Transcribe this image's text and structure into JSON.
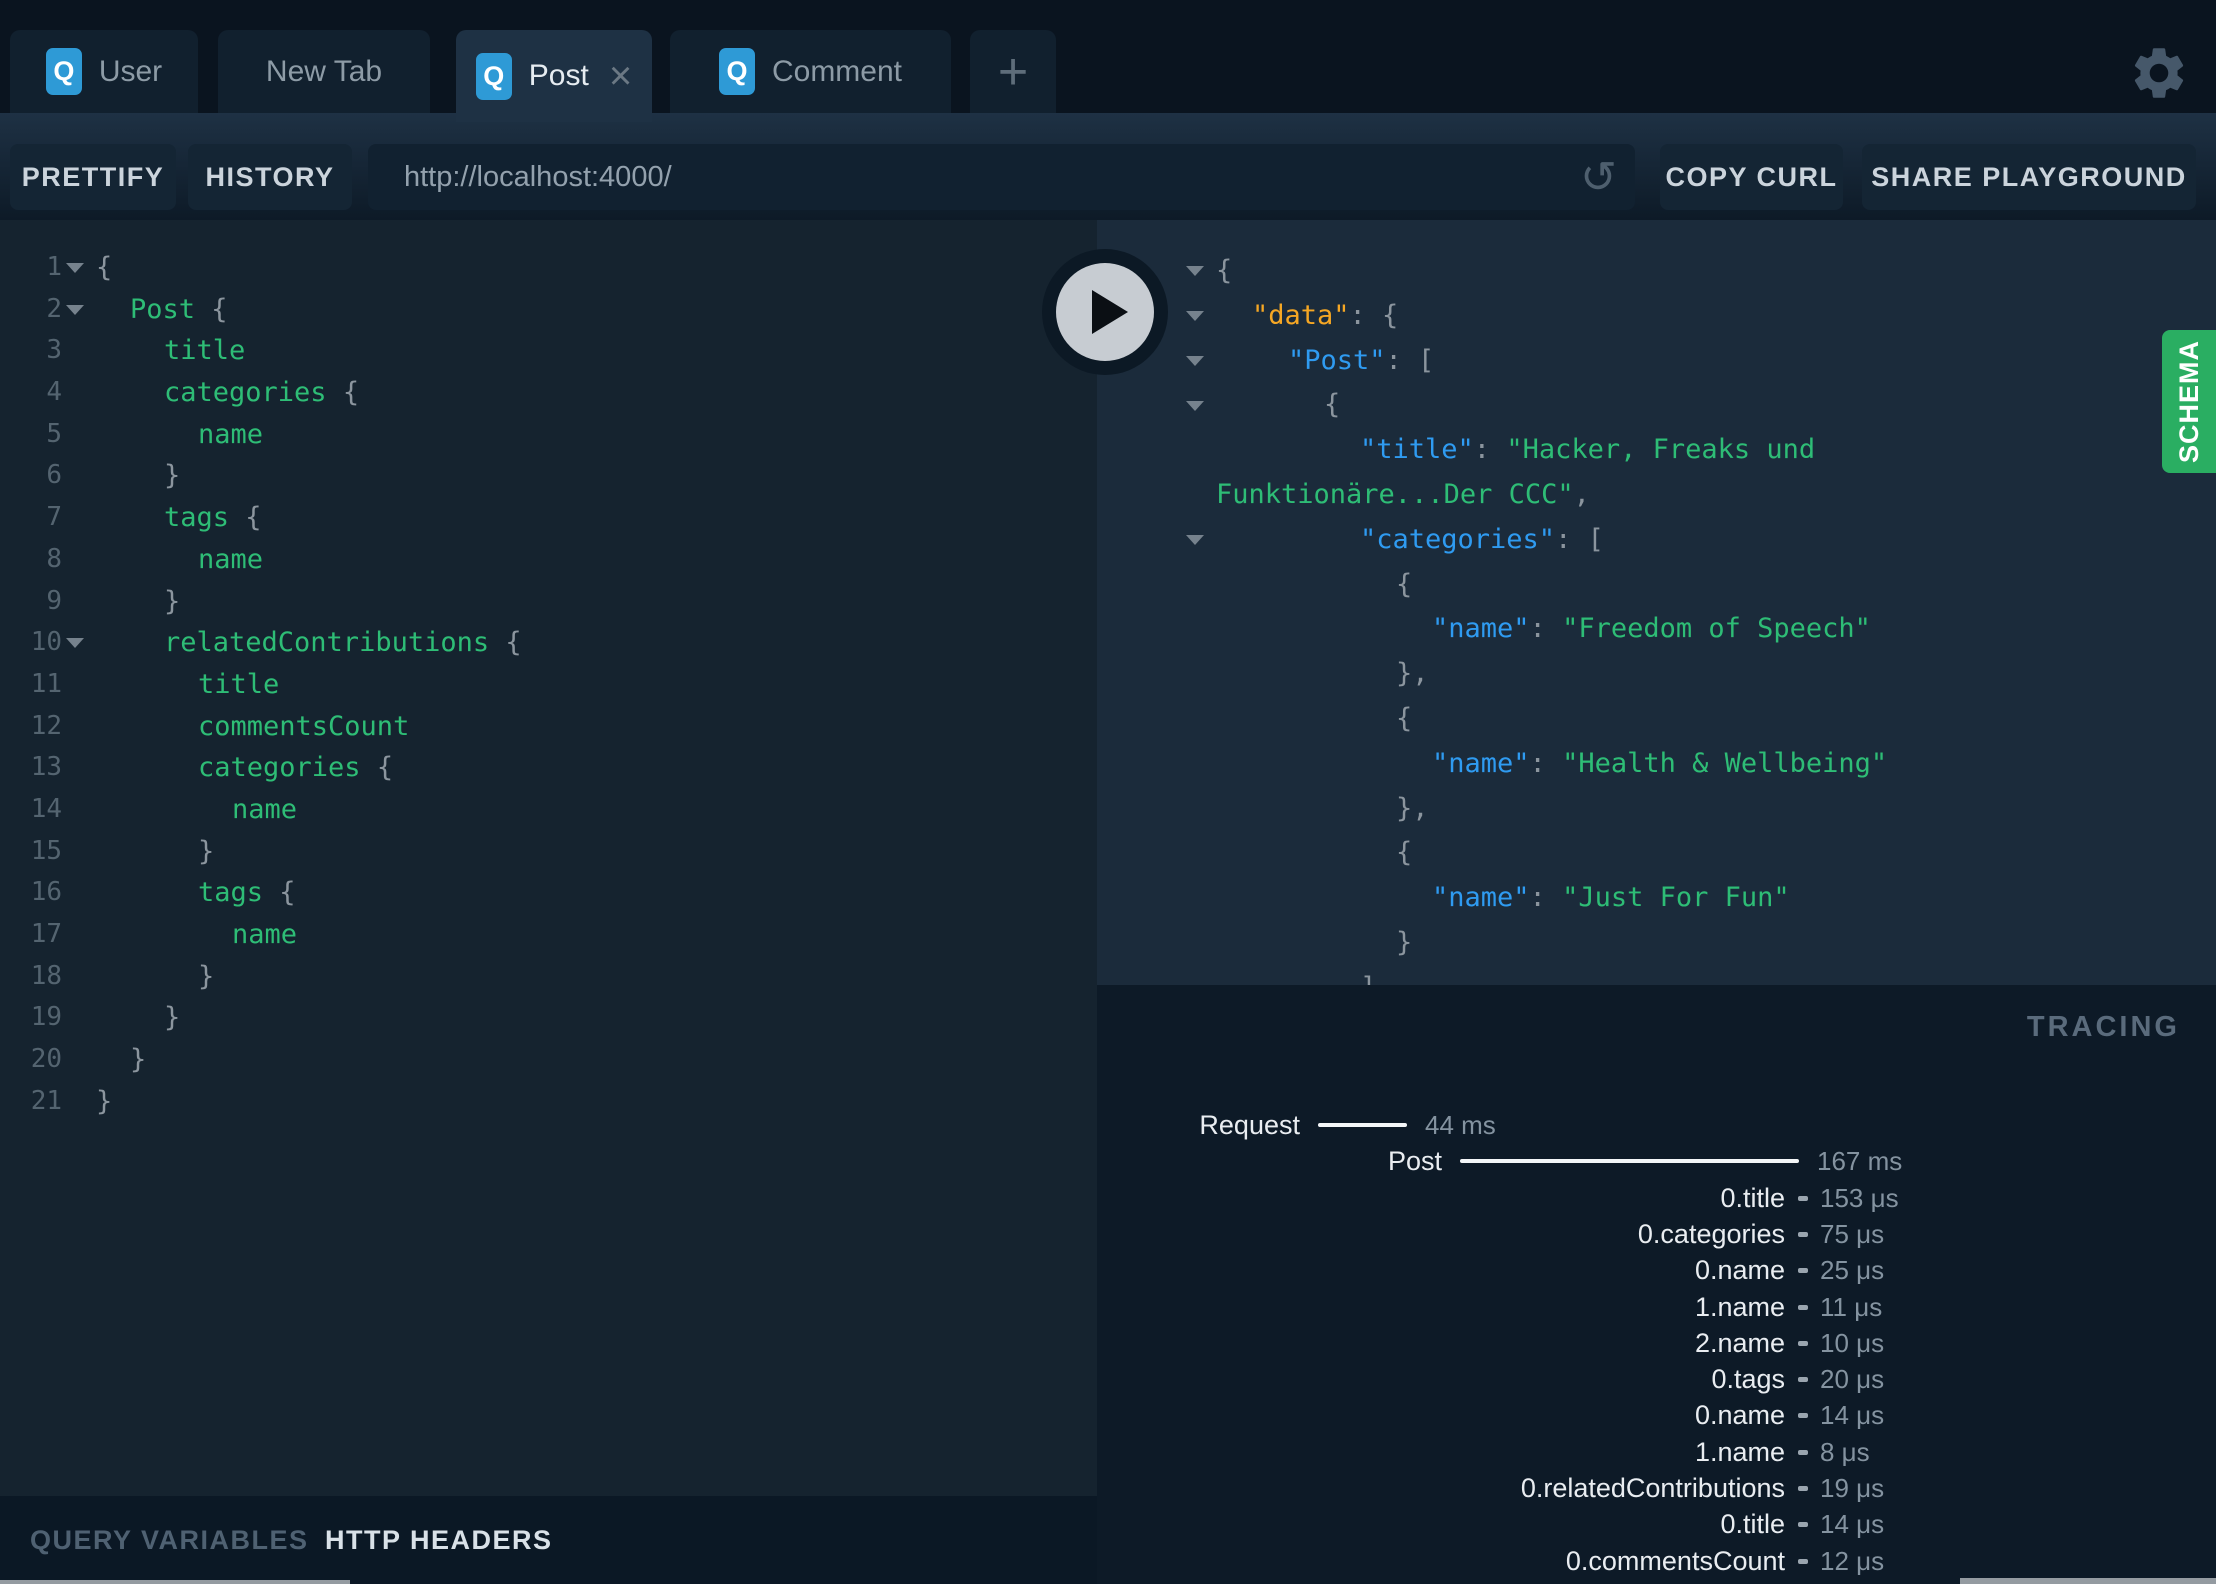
{
  "tabs": {
    "items": [
      {
        "label": "User",
        "badge": "Q",
        "active": false,
        "closable": false
      },
      {
        "label": "New Tab",
        "badge": "",
        "active": false,
        "closable": false
      },
      {
        "label": "Post",
        "badge": "Q",
        "active": true,
        "closable": true
      },
      {
        "label": "Comment",
        "badge": "Q",
        "active": false,
        "closable": false
      }
    ],
    "new_tab_button": "+",
    "close_glyph": "×"
  },
  "toolbar": {
    "prettify": "PRETTIFY",
    "history": "HISTORY",
    "url": "http://localhost:4000/",
    "reload_glyph": "↺",
    "copy_curl": "COPY CURL",
    "share": "SHARE PLAYGROUND"
  },
  "editor": {
    "lines": [
      {
        "n": 1,
        "i": 0,
        "fold": true,
        "t": [
          {
            "c": "p",
            "t": "{"
          }
        ]
      },
      {
        "n": 2,
        "i": 1,
        "fold": true,
        "t": [
          {
            "c": "f",
            "t": "Post "
          },
          {
            "c": "p",
            "t": "{"
          }
        ]
      },
      {
        "n": 3,
        "i": 2,
        "fold": false,
        "t": [
          {
            "c": "f",
            "t": "title"
          }
        ]
      },
      {
        "n": 4,
        "i": 2,
        "fold": false,
        "t": [
          {
            "c": "f",
            "t": "categories "
          },
          {
            "c": "p",
            "t": "{"
          }
        ]
      },
      {
        "n": 5,
        "i": 3,
        "fold": false,
        "t": [
          {
            "c": "f",
            "t": "name"
          }
        ]
      },
      {
        "n": 6,
        "i": 2,
        "fold": false,
        "t": [
          {
            "c": "p",
            "t": "}"
          }
        ]
      },
      {
        "n": 7,
        "i": 2,
        "fold": false,
        "t": [
          {
            "c": "f",
            "t": "tags "
          },
          {
            "c": "p",
            "t": "{"
          }
        ]
      },
      {
        "n": 8,
        "i": 3,
        "fold": false,
        "t": [
          {
            "c": "f",
            "t": "name"
          }
        ]
      },
      {
        "n": 9,
        "i": 2,
        "fold": false,
        "t": [
          {
            "c": "p",
            "t": "}"
          }
        ]
      },
      {
        "n": 10,
        "i": 2,
        "fold": true,
        "t": [
          {
            "c": "f",
            "t": "relatedContributions "
          },
          {
            "c": "p",
            "t": "{"
          }
        ]
      },
      {
        "n": 11,
        "i": 3,
        "fold": false,
        "t": [
          {
            "c": "f",
            "t": "title"
          }
        ]
      },
      {
        "n": 12,
        "i": 3,
        "fold": false,
        "t": [
          {
            "c": "f",
            "t": "commentsCount"
          }
        ]
      },
      {
        "n": 13,
        "i": 3,
        "fold": false,
        "t": [
          {
            "c": "f",
            "t": "categories "
          },
          {
            "c": "p",
            "t": "{"
          }
        ]
      },
      {
        "n": 14,
        "i": 4,
        "fold": false,
        "t": [
          {
            "c": "f",
            "t": "name"
          }
        ]
      },
      {
        "n": 15,
        "i": 3,
        "fold": false,
        "t": [
          {
            "c": "p",
            "t": "}"
          }
        ]
      },
      {
        "n": 16,
        "i": 3,
        "fold": false,
        "t": [
          {
            "c": "f",
            "t": "tags "
          },
          {
            "c": "p",
            "t": "{"
          }
        ]
      },
      {
        "n": 17,
        "i": 4,
        "fold": false,
        "t": [
          {
            "c": "f",
            "t": "name"
          }
        ]
      },
      {
        "n": 18,
        "i": 3,
        "fold": false,
        "t": [
          {
            "c": "p",
            "t": "}"
          }
        ]
      },
      {
        "n": 19,
        "i": 2,
        "fold": false,
        "t": [
          {
            "c": "p",
            "t": "}"
          }
        ]
      },
      {
        "n": 20,
        "i": 1,
        "fold": false,
        "t": [
          {
            "c": "p",
            "t": "}"
          }
        ]
      },
      {
        "n": 21,
        "i": 0,
        "fold": false,
        "t": [
          {
            "c": "p",
            "t": "}"
          }
        ]
      }
    ]
  },
  "response": {
    "lines": [
      {
        "i": 0,
        "fold": true,
        "t": [
          {
            "c": "p",
            "t": "{"
          }
        ]
      },
      {
        "i": 1,
        "fold": true,
        "t": [
          {
            "c": "o",
            "t": "\"data\""
          },
          {
            "c": "p",
            "t": ": {"
          }
        ]
      },
      {
        "i": 2,
        "fold": true,
        "t": [
          {
            "c": "b",
            "t": "\"Post\""
          },
          {
            "c": "p",
            "t": ": ["
          }
        ]
      },
      {
        "i": 3,
        "fold": true,
        "t": [
          {
            "c": "p",
            "t": "{"
          }
        ]
      },
      {
        "i": 4,
        "fold": false,
        "t": [
          {
            "c": "b",
            "t": "\"title\""
          },
          {
            "c": "p",
            "t": ": "
          },
          {
            "c": "s",
            "t": "\"Hacker, Freaks und"
          }
        ]
      },
      {
        "i": 0,
        "fold": false,
        "t": [
          {
            "c": "s",
            "t": "Funktionäre...Der CCC\""
          },
          {
            "c": "p",
            "t": ","
          }
        ]
      },
      {
        "i": 4,
        "fold": true,
        "t": [
          {
            "c": "b",
            "t": "\"categories\""
          },
          {
            "c": "p",
            "t": ": ["
          }
        ]
      },
      {
        "i": 5,
        "fold": false,
        "t": [
          {
            "c": "p",
            "t": "{"
          }
        ]
      },
      {
        "i": 6,
        "fold": false,
        "t": [
          {
            "c": "b",
            "t": "\"name\""
          },
          {
            "c": "p",
            "t": ": "
          },
          {
            "c": "s",
            "t": "\"Freedom of Speech\""
          }
        ]
      },
      {
        "i": 5,
        "fold": false,
        "t": [
          {
            "c": "p",
            "t": "},"
          }
        ]
      },
      {
        "i": 5,
        "fold": false,
        "t": [
          {
            "c": "p",
            "t": "{"
          }
        ]
      },
      {
        "i": 6,
        "fold": false,
        "t": [
          {
            "c": "b",
            "t": "\"name\""
          },
          {
            "c": "p",
            "t": ": "
          },
          {
            "c": "s",
            "t": "\"Health & Wellbeing\""
          }
        ]
      },
      {
        "i": 5,
        "fold": false,
        "t": [
          {
            "c": "p",
            "t": "},"
          }
        ]
      },
      {
        "i": 5,
        "fold": false,
        "t": [
          {
            "c": "p",
            "t": "{"
          }
        ]
      },
      {
        "i": 6,
        "fold": false,
        "t": [
          {
            "c": "b",
            "t": "\"name\""
          },
          {
            "c": "p",
            "t": ": "
          },
          {
            "c": "s",
            "t": "\"Just For Fun\""
          }
        ]
      },
      {
        "i": 5,
        "fold": false,
        "t": [
          {
            "c": "p",
            "t": "}"
          }
        ]
      },
      {
        "i": 4,
        "fold": false,
        "t": [
          {
            "c": "p",
            "t": "]"
          }
        ]
      }
    ]
  },
  "tracing": {
    "title": "TRACING",
    "rows": [
      {
        "kind": "request",
        "label": "Request",
        "value": "44 ms",
        "ms": 44
      },
      {
        "kind": "operation",
        "label": "Post",
        "value": "167 ms",
        "ms": 167
      },
      {
        "kind": "field",
        "label": "0.title",
        "value": "153 μs"
      },
      {
        "kind": "field",
        "label": "0.categories",
        "value": "75 μs"
      },
      {
        "kind": "field",
        "label": "0.name",
        "value": "25 μs"
      },
      {
        "kind": "field",
        "label": "1.name",
        "value": "11 μs"
      },
      {
        "kind": "field",
        "label": "2.name",
        "value": "10 μs"
      },
      {
        "kind": "field",
        "label": "0.tags",
        "value": "20 μs"
      },
      {
        "kind": "field",
        "label": "0.name",
        "value": "14 μs"
      },
      {
        "kind": "field",
        "label": "1.name",
        "value": "8 μs"
      },
      {
        "kind": "field",
        "label": "0.relatedContributions",
        "value": "19 μs"
      },
      {
        "kind": "field",
        "label": "0.title",
        "value": "14 μs"
      },
      {
        "kind": "field",
        "label": "0.commentsCount",
        "value": "12 μs"
      }
    ]
  },
  "footer": {
    "query_variables": "QUERY VARIABLES",
    "http_headers": "HTTP HEADERS"
  },
  "schema_tab": "SCHEMA",
  "colors": {
    "accent_blue": "#2E9AD6",
    "schema_green": "#2AAE62",
    "field_green": "#2EBD76",
    "key_blue": "#2F9BF1",
    "key_orange": "#F6A724",
    "editor_bg": "#15232F",
    "response_bg": "#1B2B3B",
    "tracing_bg": "#0D1A27"
  }
}
